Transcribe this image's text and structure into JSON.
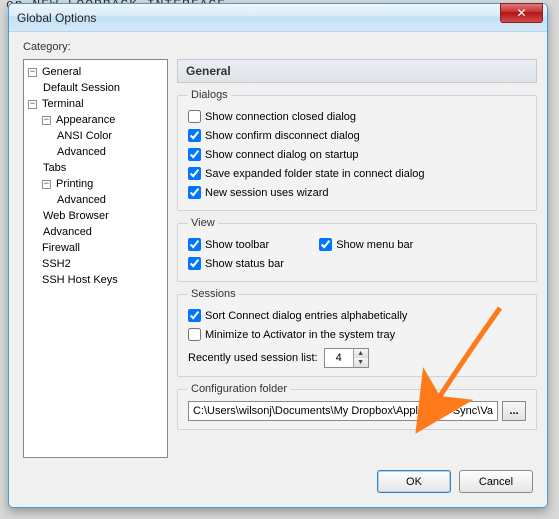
{
  "bg_partial_text": "on NEW LOOPBACK INTERFACE",
  "window": {
    "title": "Global Options",
    "close_glyph": "✕"
  },
  "category_label": "Category:",
  "tree": {
    "general": "General",
    "default_session": "Default Session",
    "terminal": "Terminal",
    "appearance": "Appearance",
    "ansi_color": "ANSI Color",
    "advanced1": "Advanced",
    "tabs": "Tabs",
    "printing": "Printing",
    "advanced2": "Advanced",
    "web_browser": "Web Browser",
    "advanced3": "Advanced",
    "firewall": "Firewall",
    "ssh2": "SSH2",
    "ssh_host_keys": "SSH Host Keys"
  },
  "panel_header": "General",
  "dialogs": {
    "legend": "Dialogs",
    "show_closed": "Show connection closed dialog",
    "show_disconnect": "Show confirm disconnect dialog",
    "show_startup": "Show connect dialog on startup",
    "save_expanded": "Save expanded folder state in connect dialog",
    "new_wizard": "New session uses wizard"
  },
  "view": {
    "legend": "View",
    "toolbar": "Show toolbar",
    "menubar": "Show menu bar",
    "statusbar": "Show status bar"
  },
  "sessions": {
    "legend": "Sessions",
    "sort_alpha": "Sort Connect dialog entries alphabetically",
    "minimize": "Minimize to Activator in the system tray",
    "recent_label": "Recently used session list:",
    "recent_value": "4"
  },
  "config": {
    "legend": "Configuration folder",
    "path": "C:\\Users\\wilsonj\\Documents\\My Dropbox\\Application Sync\\Var",
    "browse": "..."
  },
  "buttons": {
    "ok": "OK",
    "cancel": "Cancel"
  }
}
